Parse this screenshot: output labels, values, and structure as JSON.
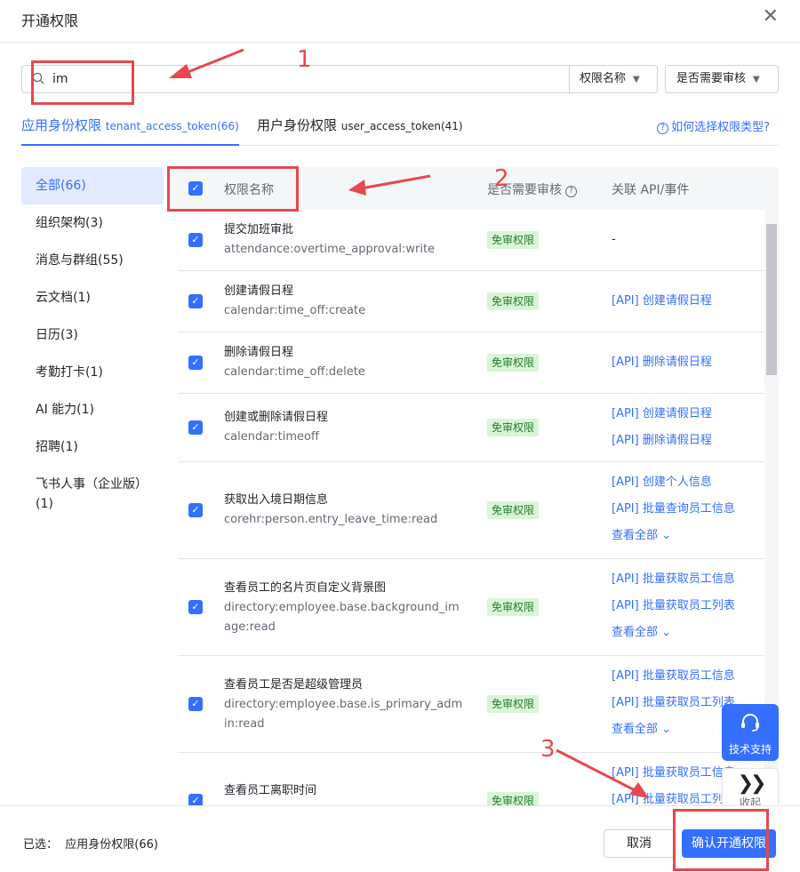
{
  "dialog": {
    "title": "开通权限"
  },
  "search": {
    "value": "im",
    "scope_select": "权限名称",
    "review_select": "是否需要审核"
  },
  "tabs": [
    {
      "label": "应用身份权限",
      "token": "tenant_access_token(66)"
    },
    {
      "label": "用户身份权限",
      "token": "user_access_token(41)"
    }
  ],
  "help_link": "如何选择权限类型?",
  "sidebar": {
    "items": [
      {
        "label": "全部(66)"
      },
      {
        "label": "组织架构(3)"
      },
      {
        "label": "消息与群组(55)"
      },
      {
        "label": "云文档(1)"
      },
      {
        "label": "日历(3)"
      },
      {
        "label": "考勤打卡(1)"
      },
      {
        "label": "AI 能力(1)"
      },
      {
        "label": "招聘(1)"
      },
      {
        "label": "飞书人事（企业版）(1)"
      }
    ]
  },
  "table": {
    "headers": {
      "name": "权限名称",
      "review": "是否需要审核",
      "api": "关联 API/事件"
    },
    "rows": [
      {
        "name": "提交加班审批",
        "scope": "attendance:overtime_approval:write",
        "badge": "免审权限",
        "apis": [],
        "dash": "-"
      },
      {
        "name": "创建请假日程",
        "scope": "calendar:time_off:create",
        "badge": "免审权限",
        "apis": [
          "[API] 创建请假日程"
        ]
      },
      {
        "name": "删除请假日程",
        "scope": "calendar:time_off:delete",
        "badge": "免审权限",
        "apis": [
          "[API] 删除请假日程"
        ]
      },
      {
        "name": "创建或删除请假日程",
        "scope": "calendar:timeoff",
        "badge": "免审权限",
        "apis": [
          "[API] 创建请假日程",
          "[API] 删除请假日程"
        ]
      },
      {
        "name": "获取出入境日期信息",
        "scope": "corehr:person.entry_leave_time:read",
        "badge": "免审权限",
        "apis": [
          "[API] 创建个人信息",
          "[API] 批量查询员工信息"
        ],
        "more": "查看全部"
      },
      {
        "name": "查看员工的名片页自定义背景图",
        "scope": "directory:employee.base.background_image:read",
        "badge": "免审权限",
        "apis": [
          "[API] 批量获取员工信息",
          "[API] 批量获取员工列表"
        ],
        "more": "查看全部"
      },
      {
        "name": "查看员工是否是超级管理员",
        "scope": "directory:employee.base.is_primary_admin:read",
        "badge": "免审权限",
        "apis": [
          "[API] 批量获取员工信息",
          "[API] 批量获取员工列表"
        ],
        "more": "查看全部"
      },
      {
        "name": "查看员工离职时间",
        "scope": "",
        "badge": "免审权限",
        "apis": [
          "[API] 批量获取员工信息",
          "[API] 批量获取员工列表"
        ]
      }
    ]
  },
  "footer": {
    "selected_label": "已选：",
    "selected_value": "应用身份权限(66)",
    "cancel": "取消",
    "confirm": "确认开通权限"
  },
  "float": {
    "support": "技术支持",
    "collapse": "收起"
  },
  "annotations": {
    "n1": "1",
    "n2": "2",
    "n3": "3"
  },
  "colors": {
    "accent": "#3370ff",
    "annotation": "#e5484d",
    "badge_bg": "#d9f5d6"
  }
}
